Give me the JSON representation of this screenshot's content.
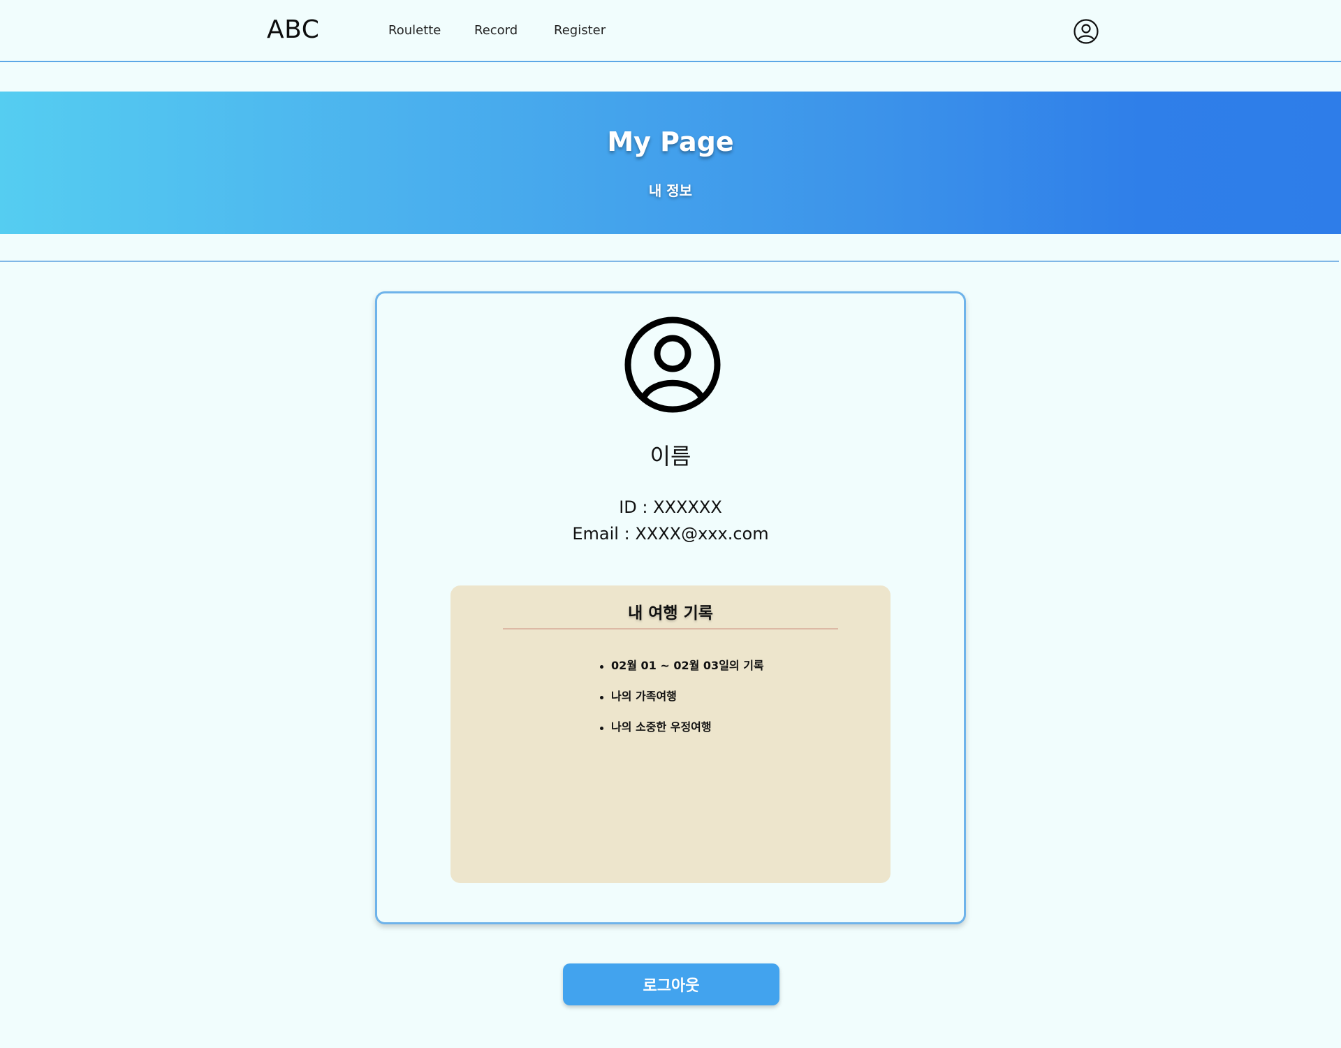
{
  "navbar": {
    "brand": "ABC",
    "links": [
      "Roulette",
      "Record",
      "Register"
    ],
    "user_icon": "user-circle-icon"
  },
  "hero": {
    "title": "My Page",
    "subtitle": "내 정보"
  },
  "profile": {
    "avatar_icon": "user-circle-icon",
    "name": "이름",
    "id_line": "ID : XXXXXX",
    "email_line": "Email : XXXX@xxx.com"
  },
  "records": {
    "title": "내 여행 기록",
    "items": [
      "02월 01 ~ 02월 03일의 기록",
      "나의 가족여행",
      "나의 소중한 우정여행"
    ]
  },
  "logout_label": "로그아웃",
  "colors": {
    "background": "#f1fdfd",
    "accent": "#42a3ee",
    "gradient_start": "#55cdf1",
    "gradient_end": "#2e7de9",
    "records_bg": "#ede5cc"
  }
}
